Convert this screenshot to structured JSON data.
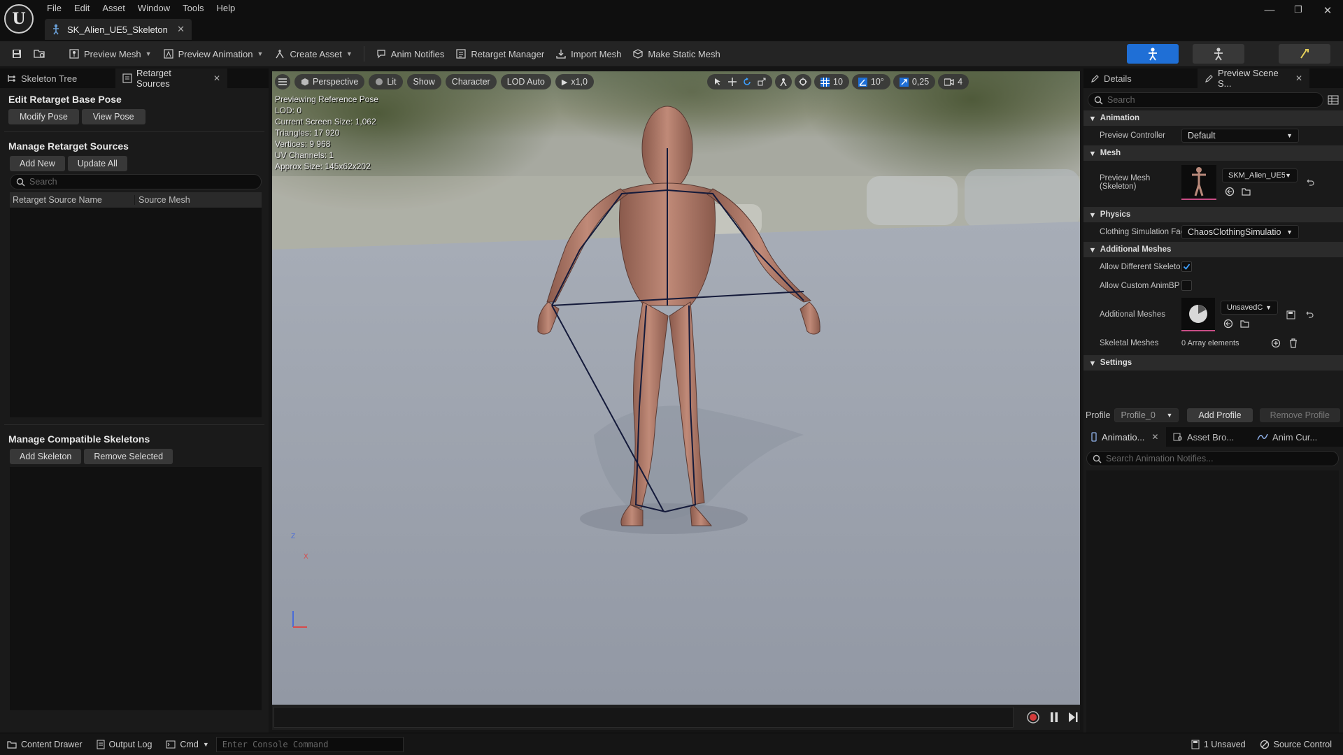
{
  "window": {
    "menu": [
      "File",
      "Edit",
      "Asset",
      "Window",
      "Tools",
      "Help"
    ],
    "doc_tab": "SK_Alien_UE5_Skeleton"
  },
  "toolbar": {
    "preview_mesh": "Preview Mesh",
    "preview_animation": "Preview Animation",
    "create_asset": "Create Asset",
    "anim_notifies": "Anim Notifies",
    "retarget_manager": "Retarget Manager",
    "import_mesh": "Import Mesh",
    "make_static_mesh": "Make Static Mesh",
    "accent": "#1f6fd6"
  },
  "left": {
    "tabs": [
      "Skeleton Tree",
      "Retarget Sources"
    ],
    "edit_pose_title": "Edit Retarget Base Pose",
    "modify_pose": "Modify Pose",
    "view_pose": "View Pose",
    "manage_sources_title": "Manage Retarget Sources",
    "add_new": "Add New",
    "update_all": "Update All",
    "search_placeholder": "Search",
    "col_source_name": "Retarget Source Name",
    "col_source_mesh": "Source Mesh",
    "compatible_title": "Manage Compatible Skeletons",
    "add_skeleton": "Add Skeleton",
    "remove_selected": "Remove Selected"
  },
  "viewport": {
    "perspective": "Perspective",
    "lit": "Lit",
    "show": "Show",
    "character": "Character",
    "lod": "LOD Auto",
    "speed": "x1,0",
    "grid_snap": "10",
    "rot_snap": "10°",
    "scale_snap": "0,25",
    "cam_speed": "4",
    "stats": [
      "Previewing Reference Pose",
      "LOD: 0",
      "Current Screen Size: 1,062",
      "Triangles: 17 920",
      "Vertices: 9 968",
      "UV Channels: 1",
      "Approx Size: 145x62x202"
    ],
    "axis_z": "Z",
    "axis_x": "X"
  },
  "right": {
    "tabs": [
      "Details",
      "Preview Scene S..."
    ],
    "search_placeholder": "Search",
    "cat_animation": "Animation",
    "preview_controller_label": "Preview Controller",
    "preview_controller_value": "Default",
    "cat_mesh": "Mesh",
    "preview_mesh_label": "Preview Mesh (Skeleton)",
    "preview_mesh_value": "SKM_Alien_UE5",
    "cat_physics": "Physics",
    "clothing_label": "Clothing Simulation Fac",
    "clothing_value": "ChaosClothingSimulatio",
    "cat_additional": "Additional Meshes",
    "allow_diff_label": "Allow Different Skeleto",
    "allow_diff_checked": true,
    "allow_custom_label": "Allow Custom AnimBP",
    "allow_custom_checked": false,
    "additional_meshes_label": "Additional Meshes",
    "additional_meshes_value": "UnsavedC",
    "skeletal_meshes_label": "Skeletal Meshes",
    "skeletal_meshes_value": "0 Array elements",
    "cat_settings": "Settings",
    "profile_label": "Profile",
    "profile_value": "Profile_0",
    "add_profile": "Add Profile",
    "remove_profile": "Remove Profile",
    "bottom_tabs": [
      "Animatio...",
      "Asset Bro...",
      "Anim Cur..."
    ],
    "notifies_placeholder": "Search Animation Notifies..."
  },
  "status": {
    "content_drawer": "Content Drawer",
    "output_log": "Output Log",
    "cmd": "Cmd",
    "console_placeholder": "Enter Console Command",
    "unsaved": "1 Unsaved",
    "source_control": "Source Control"
  }
}
